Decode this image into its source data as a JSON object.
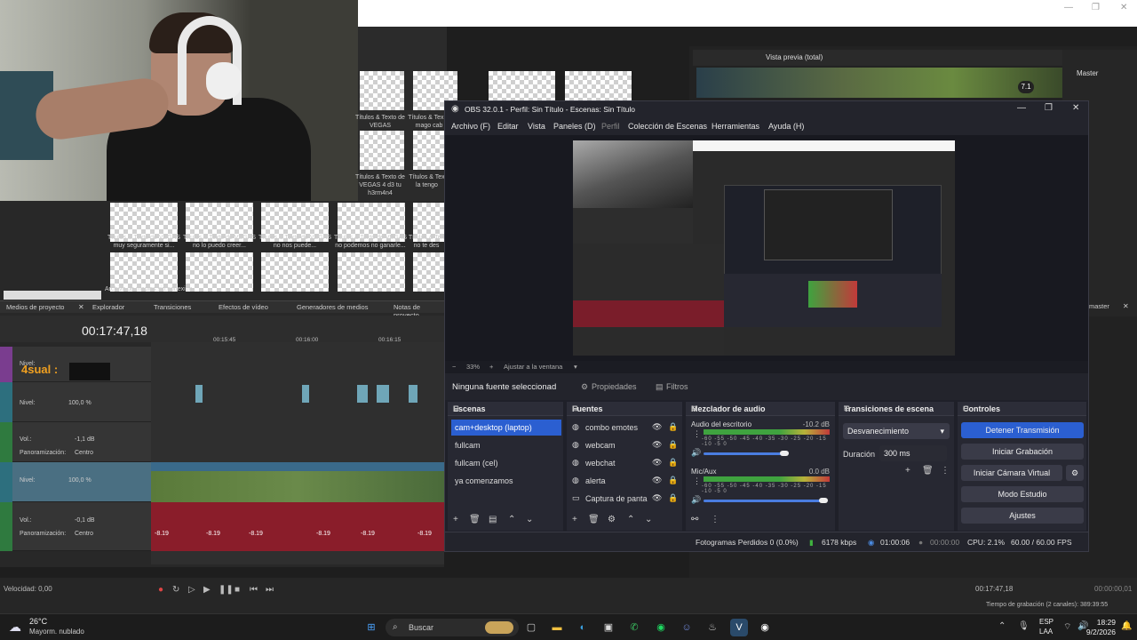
{
  "obs": {
    "title": "OBS 32.0.1 - Perfil: Sin Título - Escenas: Sin Título",
    "menu": [
      "Archivo (F)",
      "Editar",
      "Vista",
      "Paneles (D)",
      "Perfil",
      "Colección de Escenas",
      "Herramientas",
      "Ayuda (H)"
    ],
    "zoom": "33%",
    "zoom_fit": "Ajustar a la ventana",
    "no_source": "Ninguna fuente seleccionad",
    "properties_label": "Propiedades",
    "filters_label": "Filtros",
    "scenes": {
      "title": "Escenas",
      "items": [
        "cam+desktop (laptop)",
        "fullcam",
        "fullcam (cel)",
        "ya comenzamos"
      ],
      "selected": 0
    },
    "sources": {
      "title": "Fuentes",
      "items": [
        "combo emotes",
        "webcam",
        "webchat",
        "alerta",
        "Captura de panta"
      ]
    },
    "mixer": {
      "title": "Mezclador de audio",
      "channels": [
        {
          "name": "Audio del escritorio",
          "db": "-10.2 dB"
        },
        {
          "name": "Mic/Aux",
          "db": "0.0 dB"
        }
      ],
      "scale": "-60 -55 -50 -45 -40 -35 -30 -25 -20 -15 -10 -5 0"
    },
    "transitions": {
      "title": "Transiciones de escena",
      "selected": "Desvanecimiento",
      "duration_label": "Duración",
      "duration": "300 ms"
    },
    "controls": {
      "title": "Controles",
      "stop_stream": "Detener Transmisión",
      "start_rec": "Iniciar Grabación",
      "virtual_cam": "Iniciar Cámara Virtual",
      "studio": "Modo Estudio",
      "settings": "Ajustes"
    },
    "status": {
      "dropped": "Fotogramas Perdidos 0 (0.0%)",
      "bitrate": "6178 kbps",
      "stream_time": "01:00:06",
      "rec_time": "00:00:00",
      "cpu": "CPU: 2.1%",
      "fps": "60.00 / 60.00 FPS"
    }
  },
  "vegas": {
    "timecode": "00:17:47,18",
    "offline_media": "Archivo de medios sin conexión",
    "tabs": [
      "Medios de proyecto",
      "Explorador",
      "Transiciones",
      "Efectos de vídeo",
      "Generadores de medios",
      "Notas de proyecto"
    ],
    "media_items": [
      {
        "label": "Títulos & Texto de VEGAS muy seguramente si..."
      },
      {
        "label": "Títulos & Texto de VEGAS no lo puedo creer..."
      },
      {
        "label": "Títulos & Texto de VEGAS no nos puede..."
      },
      {
        "label": "Títulos & Texto de VEGAS no podemos no ganarle..."
      },
      {
        "label": "Títulos & Tex no te des"
      },
      {
        "label": "Títulos & Texto de VEGAS"
      },
      {
        "label": "Títulos & Tex el mago cab"
      },
      {
        "label": "Títulos & Texto de VEGAS 4 d3 tu h3rm4n4"
      },
      {
        "label": "Títulos & Tex la tengo"
      }
    ],
    "ruler": [
      "00:15:45",
      "00:16:00",
      "00:16:15"
    ],
    "tracks": [
      {
        "level_label": "Nivel:",
        "title": "4sual :"
      },
      {
        "level_label": "Nivel:",
        "level": "100,0 %"
      },
      {
        "vol_label": "Vol.:",
        "vol": "-1,1 dB",
        "pan_label": "Panoramización:",
        "pan": "Centro"
      },
      {
        "level_label": "Nivel:",
        "level": "100,0 %"
      },
      {
        "vol_label": "Vol.:",
        "vol": "-0,1 dB",
        "pan_label": "Panoramización:",
        "pan": "Centro"
      }
    ],
    "clip_db": "-8.19",
    "velocity_label": "Velocidad: 0,00",
    "end_timecode": "00:17:47,18",
    "end_timecode2": "00:00:00,01",
    "rec_time_label": "Tiempo de grabación (2 canales): 389:39:55",
    "right_bar": "Vista previa (total)",
    "master_label": "Master",
    "master_bus": "master",
    "score": "7.1"
  },
  "taskbar": {
    "weather_temp": "26°C",
    "weather_desc": "Mayorm. nublado",
    "search_placeholder": "Buscar",
    "lang": "ESP",
    "lang2": "LAA",
    "time": "18:29",
    "date": "9/2/2026"
  }
}
